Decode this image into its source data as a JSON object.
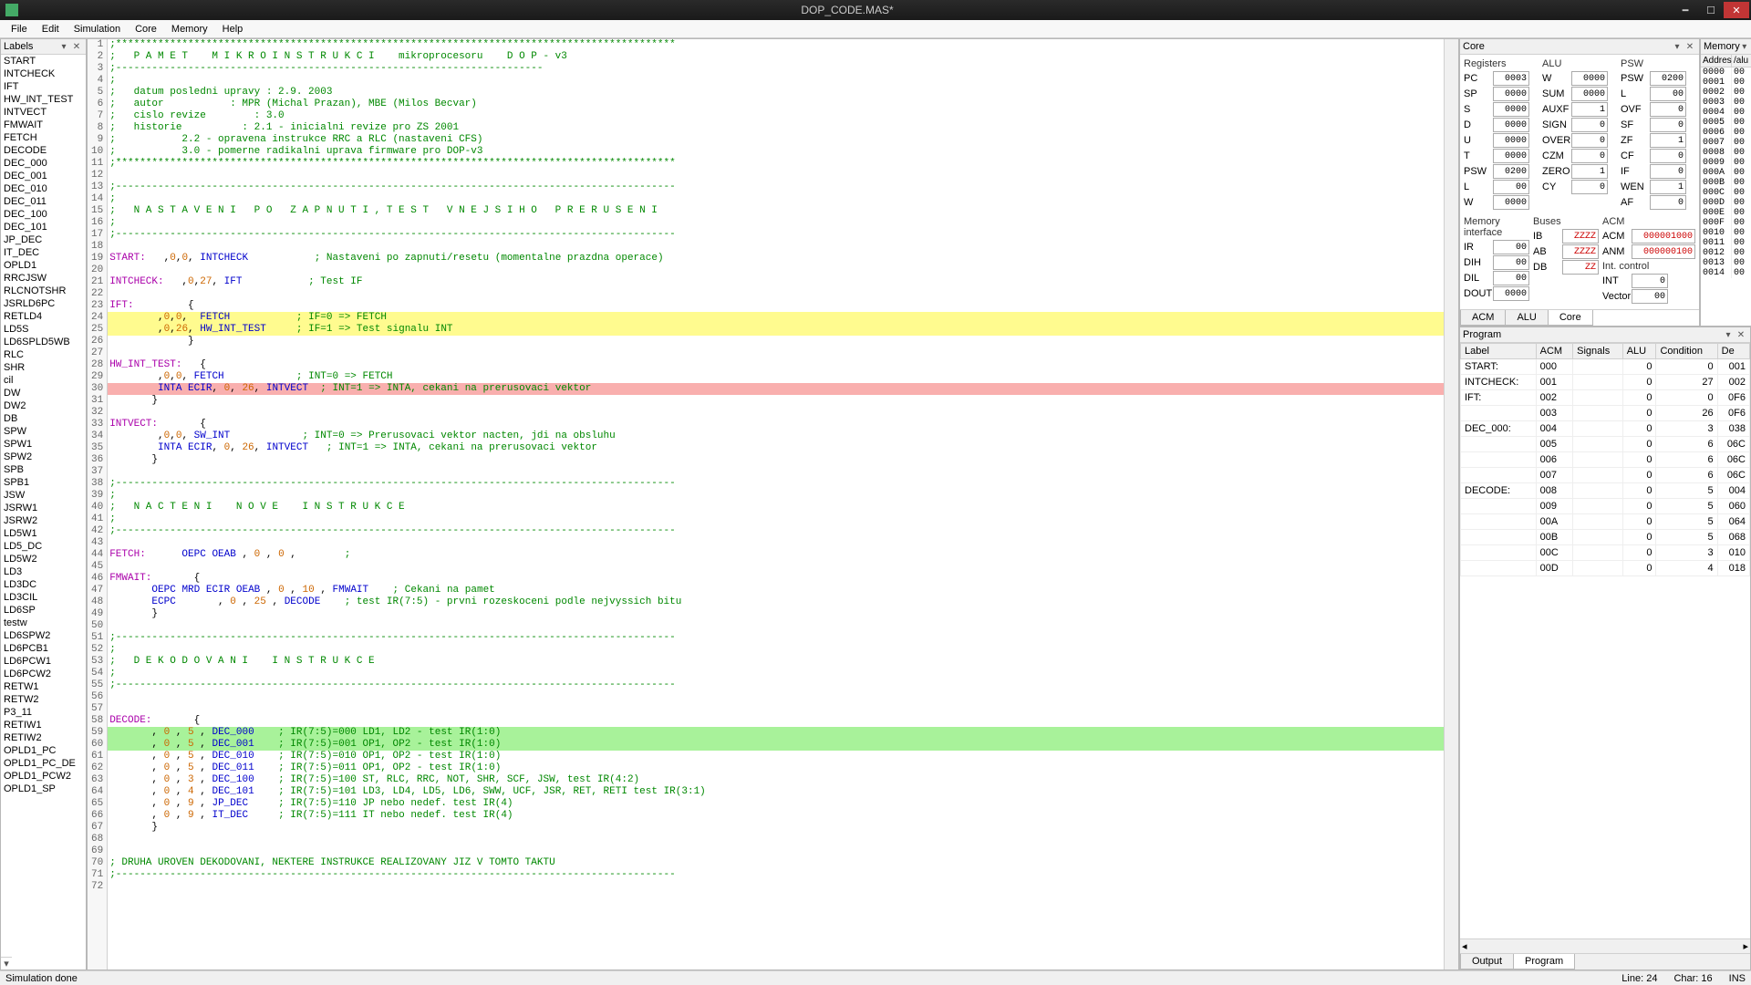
{
  "window": {
    "title": "DOP_CODE.MAS*"
  },
  "menu": [
    "File",
    "Edit",
    "Simulation",
    "Core",
    "Memory",
    "Help"
  ],
  "labels_panel": {
    "title": "Labels",
    "items": [
      "START",
      "INTCHECK",
      "IFT",
      "HW_INT_TEST",
      "INTVECT",
      "FMWAIT",
      "FETCH",
      "DECODE",
      "DEC_000",
      "DEC_001",
      "DEC_010",
      "DEC_011",
      "DEC_100",
      "DEC_101",
      "JP_DEC",
      "IT_DEC",
      "OPLD1",
      "RRCJSW",
      "RLCNOTSHR",
      "JSRLD6PC",
      "RETLD4",
      "LD5S",
      "LD6SPLD5WB",
      "RLC",
      "SHR",
      "cil",
      "DW",
      "DW2",
      "DB",
      "SPW",
      "SPW1",
      "SPW2",
      "SPB",
      "SPB1",
      "JSW",
      "JSRW1",
      "JSRW2",
      "LD5W1",
      "LD5_DC",
      "LD5W2",
      "LD3",
      "LD3DC",
      "LD3CIL",
      "LD6SP",
      "testw",
      "LD6SPW2",
      "LD6PCB1",
      "LD6PCW1",
      "LD6PCW2",
      "RETW1",
      "RETW2",
      "P3_11",
      "RETIW1",
      "RETIW2",
      "OPLD1_PC",
      "OPLD1_PC_DE",
      "OPLD1_PCW2",
      "OPLD1_SP"
    ]
  },
  "editor": {
    "lines": [
      {
        "n": 1,
        "t": ";*********************************************************************************************"
      },
      {
        "n": 2,
        "t": ";   P A M E T    M I K R O I N S T R U K C I    mikroprocesoru    D O P - v3"
      },
      {
        "n": 3,
        "t": ";-----------------------------------------------------------------------"
      },
      {
        "n": 4,
        "t": ";"
      },
      {
        "n": 5,
        "t": ";   datum posledni upravy : 2.9. 2003"
      },
      {
        "n": 6,
        "t": ";   autor           : MPR (Michal Prazan), MBE (Milos Becvar)"
      },
      {
        "n": 7,
        "t": ";   cislo revize        : 3.0"
      },
      {
        "n": 8,
        "t": ";   historie          : 2.1 - inicialni revize pro ZS 2001"
      },
      {
        "n": 9,
        "t": ";           2.2 - opravena instrukce RRC a RLC (nastaveni CFS)"
      },
      {
        "n": 10,
        "t": ";           3.0 - pomerne radikalni uprava firmware pro DOP-v3"
      },
      {
        "n": 11,
        "t": ";*********************************************************************************************"
      },
      {
        "n": 12,
        "t": ""
      },
      {
        "n": 13,
        "t": ";---------------------------------------------------------------------------------------------"
      },
      {
        "n": 14,
        "t": ";"
      },
      {
        "n": 15,
        "t": ";   N A S T A V E N I   P O   Z A P N U T I , T E S T   V N E J S I H O   P R E R U S E N I"
      },
      {
        "n": 16,
        "t": ";"
      },
      {
        "n": 17,
        "t": ";---------------------------------------------------------------------------------------------"
      },
      {
        "n": 18,
        "t": ""
      },
      {
        "n": 19,
        "t": "START:   ,0,0, INTCHECK           ; Nastaveni po zapnuti/resetu (momentalne prazdna operace)"
      },
      {
        "n": 20,
        "t": ""
      },
      {
        "n": 21,
        "t": "INTCHECK:   ,0,27, IFT           ; Test IF"
      },
      {
        "n": 22,
        "t": ""
      },
      {
        "n": 23,
        "t": "IFT:         {"
      },
      {
        "n": 24,
        "t": "        ,0,0,  FETCH           ; IF=0 => FETCH",
        "hl": "yellow"
      },
      {
        "n": 25,
        "t": "        ,0,26, HW_INT_TEST     ; IF=1 => Test signalu INT",
        "hl": "yellow"
      },
      {
        "n": 26,
        "t": "             }"
      },
      {
        "n": 27,
        "t": ""
      },
      {
        "n": 28,
        "t": "HW_INT_TEST:   {"
      },
      {
        "n": 29,
        "t": "        ,0,0, FETCH            ; INT=0 => FETCH"
      },
      {
        "n": 30,
        "t": "        INTA ECIR, 0, 26, INTVECT  ; INT=1 => INTA, cekani na prerusovaci vektor",
        "hl": "red"
      },
      {
        "n": 31,
        "t": "       }"
      },
      {
        "n": 32,
        "t": ""
      },
      {
        "n": 33,
        "t": "INTVECT:       {"
      },
      {
        "n": 34,
        "t": "        ,0,0, SW_INT            ; INT=0 => Prerusovaci vektor nacten, jdi na obsluhu"
      },
      {
        "n": 35,
        "t": "        INTA ECIR, 0, 26, INTVECT   ; INT=1 => INTA, cekani na prerusovaci vektor"
      },
      {
        "n": 36,
        "t": "       }"
      },
      {
        "n": 37,
        "t": ""
      },
      {
        "n": 38,
        "t": ";---------------------------------------------------------------------------------------------"
      },
      {
        "n": 39,
        "t": ";"
      },
      {
        "n": 40,
        "t": ";   N A C T E N I    N O V E    I N S T R U K C E"
      },
      {
        "n": 41,
        "t": ";"
      },
      {
        "n": 42,
        "t": ";---------------------------------------------------------------------------------------------"
      },
      {
        "n": 43,
        "t": ""
      },
      {
        "n": 44,
        "t": "FETCH:      OEPC OEAB , 0 , 0 ,        ;"
      },
      {
        "n": 45,
        "t": ""
      },
      {
        "n": 46,
        "t": "FMWAIT:       {"
      },
      {
        "n": 47,
        "t": "       OEPC MRD ECIR OEAB , 0 , 10 , FMWAIT    ; Cekani na pamet"
      },
      {
        "n": 48,
        "t": "       ECPC       , 0 , 25 , DECODE    ; test IR(7:5) - prvni rozeskoceni podle nejvyssich bitu"
      },
      {
        "n": 49,
        "t": "       }"
      },
      {
        "n": 50,
        "t": ""
      },
      {
        "n": 51,
        "t": ";---------------------------------------------------------------------------------------------"
      },
      {
        "n": 52,
        "t": ";"
      },
      {
        "n": 53,
        "t": ";   D E K O D O V A N I    I N S T R U K C E"
      },
      {
        "n": 54,
        "t": ";"
      },
      {
        "n": 55,
        "t": ";---------------------------------------------------------------------------------------------"
      },
      {
        "n": 56,
        "t": ""
      },
      {
        "n": 57,
        "t": ""
      },
      {
        "n": 58,
        "t": "DECODE:       {"
      },
      {
        "n": 59,
        "t": "       , 0 , 5 , DEC_000    ; IR(7:5)=000 LD1, LD2 - test IR(1:0)",
        "hl": "green"
      },
      {
        "n": 60,
        "t": "       , 0 , 5 , DEC_001    ; IR(7:5)=001 OP1, OP2 - test IR(1:0)",
        "hl": "green"
      },
      {
        "n": 61,
        "t": "       , 0 , 5 , DEC_010    ; IR(7:5)=010 OP1, OP2 - test IR(1:0)"
      },
      {
        "n": 62,
        "t": "       , 0 , 5 , DEC_011    ; IR(7:5)=011 OP1, OP2 - test IR(1:0)"
      },
      {
        "n": 63,
        "t": "       , 0 , 3 , DEC_100    ; IR(7:5)=100 ST, RLC, RRC, NOT, SHR, SCF, JSW, test IR(4:2)"
      },
      {
        "n": 64,
        "t": "       , 0 , 4 , DEC_101    ; IR(7:5)=101 LD3, LD4, LD5, LD6, SWW, UCF, JSR, RET, RETI test IR(3:1)"
      },
      {
        "n": 65,
        "t": "       , 0 , 9 , JP_DEC     ; IR(7:5)=110 JP nebo nedef. test IR(4)"
      },
      {
        "n": 66,
        "t": "       , 0 , 9 , IT_DEC     ; IR(7:5)=111 IT nebo nedef. test IR(4)"
      },
      {
        "n": 67,
        "t": "       }"
      },
      {
        "n": 68,
        "t": ""
      },
      {
        "n": 69,
        "t": ""
      },
      {
        "n": 70,
        "t": "; DRUHA UROVEN DEKODOVANI, NEKTERE INSTRUKCE REALIZOVANY JIZ V TOMTO TAKTU"
      },
      {
        "n": 71,
        "t": ";---------------------------------------------------------------------------------------------"
      },
      {
        "n": 72,
        "t": ""
      }
    ]
  },
  "core": {
    "title": "Core",
    "registers": {
      "title": "Registers",
      "rows": [
        [
          "PC",
          "0003"
        ],
        [
          "SP",
          "0000"
        ],
        [
          "S",
          "0000"
        ],
        [
          "D",
          "0000"
        ],
        [
          "U",
          "0000"
        ],
        [
          "T",
          "0000"
        ],
        [
          "PSW",
          "0200"
        ],
        [
          "L",
          "00"
        ],
        [
          "W",
          "0000"
        ]
      ]
    },
    "alu": {
      "title": "ALU",
      "rows": [
        [
          "W",
          "0000"
        ],
        [
          "SUM",
          "0000"
        ],
        [
          "AUXF",
          "1"
        ],
        [
          "SIGN",
          "0"
        ],
        [
          "OVERF",
          "0"
        ],
        [
          "CZM",
          "0"
        ],
        [
          "ZERO",
          "1"
        ],
        [
          "CY",
          "0"
        ]
      ]
    },
    "psw": {
      "title": "PSW",
      "rows": [
        [
          "PSW",
          "0200"
        ],
        [
          "L",
          "00"
        ],
        [
          "OVF",
          "0"
        ],
        [
          "SF",
          "0"
        ],
        [
          "ZF",
          "1"
        ],
        [
          "CF",
          "0"
        ],
        [
          "IF",
          "0"
        ],
        [
          "WEN",
          "1"
        ],
        [
          "AF",
          "0"
        ]
      ]
    },
    "mem_if": {
      "title": "Memory interface",
      "rows": [
        [
          "IR",
          "00"
        ],
        [
          "DIH",
          "00"
        ],
        [
          "DIL",
          "00"
        ],
        [
          "DOUT",
          "0000"
        ]
      ]
    },
    "buses": {
      "title": "Buses",
      "rows": [
        [
          "IB",
          "ZZZZ",
          true
        ],
        [
          "AB",
          "ZZZZ",
          true
        ],
        [
          "DB",
          "ZZ",
          true
        ]
      ]
    },
    "acm": {
      "title": "ACM",
      "rows": [
        [
          "ACM",
          "000001000",
          true
        ],
        [
          "ANM",
          "000000100",
          true
        ]
      ]
    },
    "intc": {
      "title": "Int. control",
      "rows": [
        [
          "INT",
          "0"
        ],
        [
          "Vector",
          "00"
        ]
      ]
    },
    "tabs": [
      "ACM",
      "ALU",
      "Core"
    ],
    "active_tab": 2
  },
  "memory": {
    "title": "Memory",
    "headers": [
      "Addres",
      "/alu"
    ],
    "rows": [
      [
        "0000",
        "00"
      ],
      [
        "0001",
        "00"
      ],
      [
        "0002",
        "00"
      ],
      [
        "0003",
        "00"
      ],
      [
        "0004",
        "00"
      ],
      [
        "0005",
        "00"
      ],
      [
        "0006",
        "00"
      ],
      [
        "0007",
        "00"
      ],
      [
        "0008",
        "00"
      ],
      [
        "0009",
        "00"
      ],
      [
        "000A",
        "00"
      ],
      [
        "000B",
        "00"
      ],
      [
        "000C",
        "00"
      ],
      [
        "000D",
        "00"
      ],
      [
        "000E",
        "00"
      ],
      [
        "000F",
        "00"
      ],
      [
        "0010",
        "00"
      ],
      [
        "0011",
        "00"
      ],
      [
        "0012",
        "00"
      ],
      [
        "0013",
        "00"
      ],
      [
        "0014",
        "00"
      ]
    ]
  },
  "program": {
    "title": "Program",
    "headers": [
      "Label",
      "ACM",
      "Signals",
      "ALU",
      "Condition",
      "De"
    ],
    "rows": [
      {
        "label": "START:",
        "acm": "000",
        "signals": "",
        "alu": "0",
        "cond": "0",
        "de": "001"
      },
      {
        "label": "INTCHECK:",
        "acm": "001",
        "signals": "",
        "alu": "0",
        "cond": "27",
        "de": "002"
      },
      {
        "label": "IFT:",
        "acm": "002",
        "signals": "",
        "alu": "0",
        "cond": "0",
        "de": "0F6"
      },
      {
        "label": "",
        "acm": "003",
        "signals": "",
        "alu": "0",
        "cond": "26",
        "de": "0F6"
      },
      {
        "label": "DEC_000:",
        "acm": "004",
        "signals": "",
        "alu": "0",
        "cond": "3",
        "de": "038"
      },
      {
        "label": "",
        "acm": "005",
        "signals": "",
        "alu": "0",
        "cond": "6",
        "de": "06C"
      },
      {
        "label": "",
        "acm": "006",
        "signals": "",
        "alu": "0",
        "cond": "6",
        "de": "06C"
      },
      {
        "label": "",
        "acm": "007",
        "signals": "",
        "alu": "0",
        "cond": "6",
        "de": "06C"
      },
      {
        "label": "DECODE:",
        "acm": "008",
        "signals": "",
        "alu": "0",
        "cond": "5",
        "de": "004"
      },
      {
        "label": "",
        "acm": "009",
        "signals": "",
        "alu": "0",
        "cond": "5",
        "de": "060"
      },
      {
        "label": "",
        "acm": "00A",
        "signals": "",
        "alu": "0",
        "cond": "5",
        "de": "064"
      },
      {
        "label": "",
        "acm": "00B",
        "signals": "",
        "alu": "0",
        "cond": "5",
        "de": "068"
      },
      {
        "label": "",
        "acm": "00C",
        "signals": "",
        "alu": "0",
        "cond": "3",
        "de": "010"
      },
      {
        "label": "",
        "acm": "00D",
        "signals": "",
        "alu": "0",
        "cond": "4",
        "de": "018"
      }
    ],
    "tabs": [
      "Output",
      "Program"
    ],
    "active_tab": 1
  },
  "status": {
    "left": "Simulation done",
    "line": "Line: 24",
    "char": "Char: 16",
    "ins": "INS"
  }
}
